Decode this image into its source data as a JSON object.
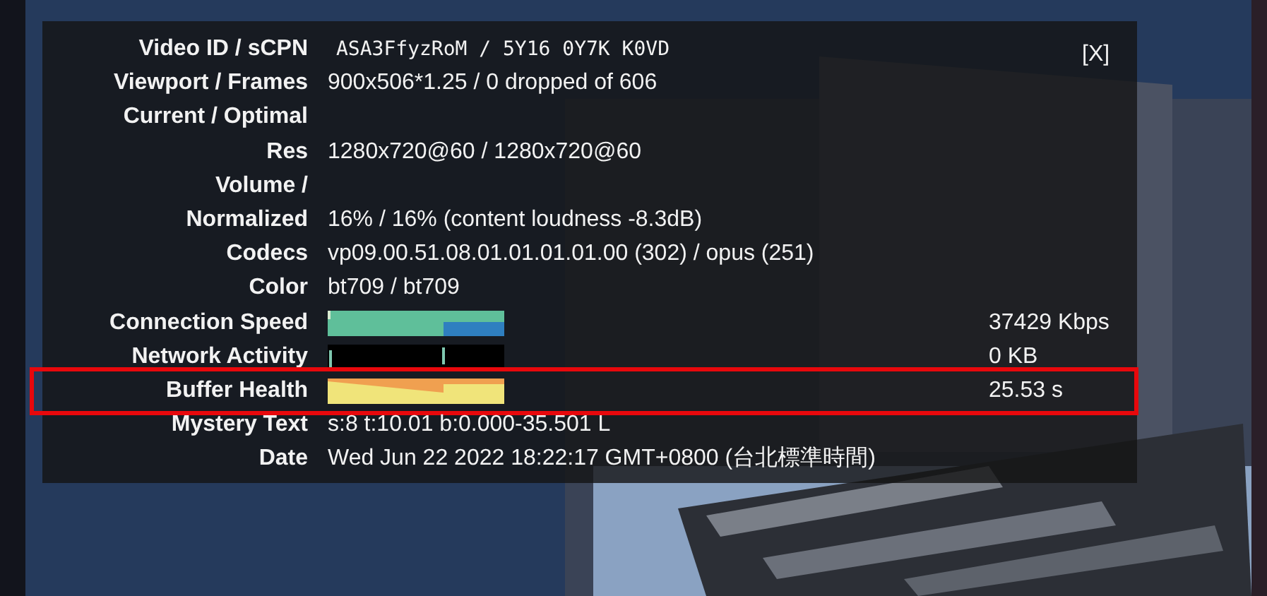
{
  "close_label": "[X]",
  "rows": [
    {
      "kind": "code",
      "label": "Video ID / sCPN",
      "value": "ASA3FfyzRoM / 5Y16 0Y7K K0VD",
      "highlighted": false
    },
    {
      "kind": "text",
      "label": "Viewport / Frames",
      "value": "900x506*1.25 / 0 dropped of 606",
      "highlighted": false
    },
    {
      "kind": "label",
      "label": "Current / Optimal",
      "highlighted": false
    },
    {
      "kind": "text",
      "label": "Res",
      "value": "1280x720@60 / 1280x720@60",
      "highlighted": false
    },
    {
      "kind": "label",
      "label": "Volume /",
      "highlighted": false
    },
    {
      "kind": "text",
      "label": "Normalized",
      "value": "16% / 16% (content loudness -8.3dB)",
      "highlighted": false
    },
    {
      "kind": "text",
      "label": "Codecs",
      "value": "vp09.00.51.08.01.01.01.01.00 (302) / opus (251)",
      "highlighted": false
    },
    {
      "kind": "text",
      "label": "Color",
      "value": "bt709 / bt709",
      "highlighted": false
    },
    {
      "kind": "speed",
      "label": "Connection Speed",
      "value": "37429 Kbps",
      "highlighted": false
    },
    {
      "kind": "activity",
      "label": "Network Activity",
      "value": "0 KB",
      "highlighted": false
    },
    {
      "kind": "buffer",
      "label": "Buffer Health",
      "value": "25.53 s",
      "highlighted": true
    },
    {
      "kind": "text",
      "label": "Mystery Text",
      "value": "s:8 t:10.01 b:0.000-35.501 L",
      "highlighted": false
    },
    {
      "kind": "text",
      "label": "Date",
      "value": "Wed Jun 22 2022 18:22:17 GMT+0800 (台北標準時間)",
      "highlighted": false
    }
  ]
}
